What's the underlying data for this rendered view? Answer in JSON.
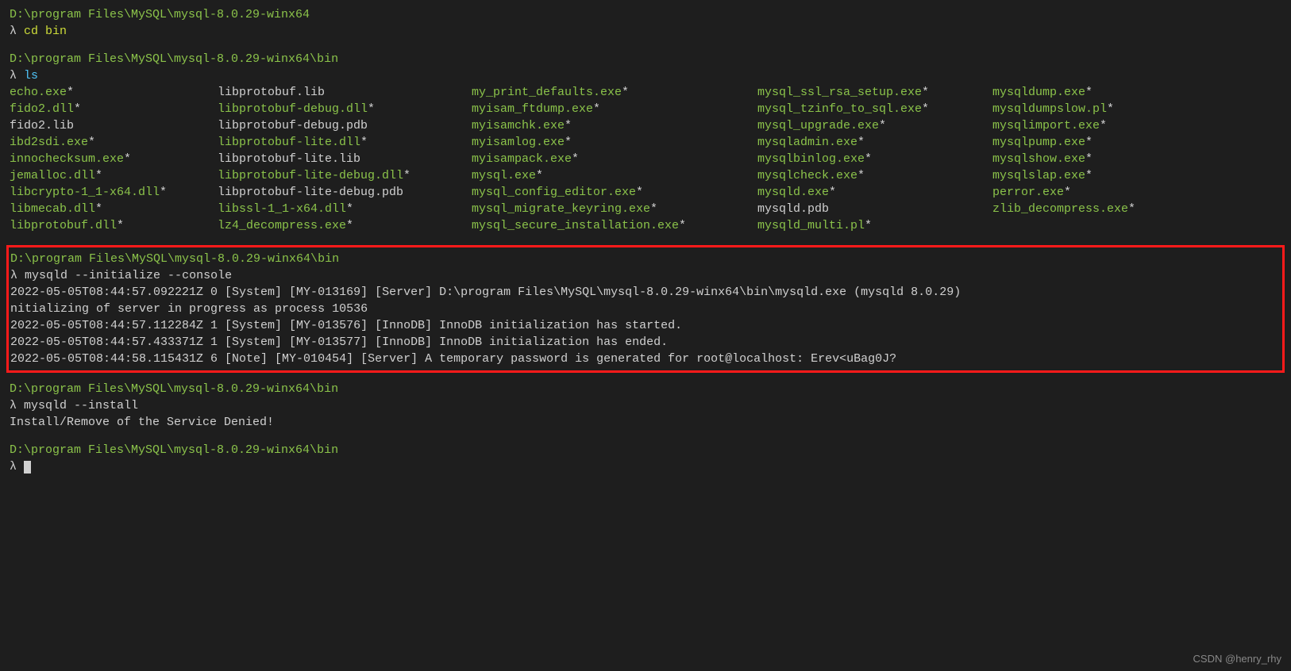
{
  "paths": {
    "root": "D:\\program Files\\MySQL\\mysql-8.0.29-winx64",
    "bin": "D:\\program Files\\MySQL\\mysql-8.0.29-winx64\\bin"
  },
  "prompt": "λ",
  "commands": {
    "cd_bin": "cd bin",
    "ls": "ls",
    "init": "mysqld --initialize --console",
    "install": "mysqld --install"
  },
  "ls_output": {
    "rows": [
      [
        {
          "t": "echo.exe",
          "s": "*"
        },
        {
          "t": "libprotobuf.lib",
          "s": ""
        },
        {
          "t": "my_print_defaults.exe",
          "s": "*"
        },
        {
          "t": "mysql_ssl_rsa_setup.exe",
          "s": "*"
        },
        {
          "t": "mysqldump.exe",
          "s": "*"
        }
      ],
      [
        {
          "t": "fido2.dll",
          "s": "*"
        },
        {
          "t": "libprotobuf-debug.dll",
          "s": "*"
        },
        {
          "t": "myisam_ftdump.exe",
          "s": "*"
        },
        {
          "t": "mysql_tzinfo_to_sql.exe",
          "s": "*"
        },
        {
          "t": "mysqldumpslow.pl",
          "s": "*"
        }
      ],
      [
        {
          "t": "fido2.lib",
          "s": ""
        },
        {
          "t": "libprotobuf-debug.pdb",
          "s": ""
        },
        {
          "t": "myisamchk.exe",
          "s": "*"
        },
        {
          "t": "mysql_upgrade.exe",
          "s": "*"
        },
        {
          "t": "mysqlimport.exe",
          "s": "*"
        }
      ],
      [
        {
          "t": "ibd2sdi.exe",
          "s": "*"
        },
        {
          "t": "libprotobuf-lite.dll",
          "s": "*"
        },
        {
          "t": "myisamlog.exe",
          "s": "*"
        },
        {
          "t": "mysqladmin.exe",
          "s": "*"
        },
        {
          "t": "mysqlpump.exe",
          "s": "*"
        }
      ],
      [
        {
          "t": "innochecksum.exe",
          "s": "*"
        },
        {
          "t": "libprotobuf-lite.lib",
          "s": ""
        },
        {
          "t": "myisampack.exe",
          "s": "*"
        },
        {
          "t": "mysqlbinlog.exe",
          "s": "*"
        },
        {
          "t": "mysqlshow.exe",
          "s": "*"
        }
      ],
      [
        {
          "t": "jemalloc.dll",
          "s": "*"
        },
        {
          "t": "libprotobuf-lite-debug.dll",
          "s": "*"
        },
        {
          "t": "mysql.exe",
          "s": "*"
        },
        {
          "t": "mysqlcheck.exe",
          "s": "*"
        },
        {
          "t": "mysqlslap.exe",
          "s": "*"
        }
      ],
      [
        {
          "t": "libcrypto-1_1-x64.dll",
          "s": "*"
        },
        {
          "t": "libprotobuf-lite-debug.pdb",
          "s": ""
        },
        {
          "t": "mysql_config_editor.exe",
          "s": "*"
        },
        {
          "t": "mysqld.exe",
          "s": "*"
        },
        {
          "t": "perror.exe",
          "s": "*"
        }
      ],
      [
        {
          "t": "libmecab.dll",
          "s": "*"
        },
        {
          "t": "libssl-1_1-x64.dll",
          "s": "*"
        },
        {
          "t": "mysql_migrate_keyring.exe",
          "s": "*"
        },
        {
          "t": "mysqld.pdb",
          "s": ""
        },
        {
          "t": "zlib_decompress.exe",
          "s": "*"
        }
      ],
      [
        {
          "t": "libprotobuf.dll",
          "s": "*"
        },
        {
          "t": "lz4_decompress.exe",
          "s": "*"
        },
        {
          "t": "mysql_secure_installation.exe",
          "s": "*"
        },
        {
          "t": "mysqld_multi.pl",
          "s": "*"
        },
        {
          "t": "",
          "s": ""
        }
      ]
    ]
  },
  "init_output": [
    "2022-05-05T08:44:57.092221Z 0 [System] [MY-013169] [Server] D:\\program Files\\MySQL\\mysql-8.0.29-winx64\\bin\\mysqld.exe (mysqld 8.0.29)",
    "nitializing of server in progress as process 10536",
    "2022-05-05T08:44:57.112284Z 1 [System] [MY-013576] [InnoDB] InnoDB initialization has started.",
    "2022-05-05T08:44:57.433371Z 1 [System] [MY-013577] [InnoDB] InnoDB initialization has ended.",
    "2022-05-05T08:44:58.115431Z 6 [Note] [MY-010454] [Server] A temporary password is generated for root@localhost: Erev<uBag0J?"
  ],
  "install_output": "Install/Remove of the Service Denied!",
  "watermark": "CSDN @henry_rhy"
}
